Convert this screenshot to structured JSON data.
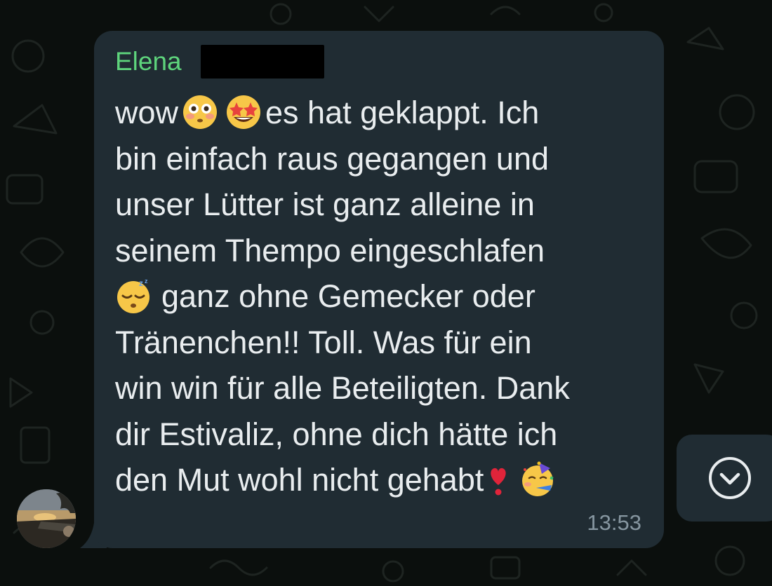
{
  "chat": {
    "sender_name": "Elena",
    "message_lines": [
      "wow",
      "es hat geklappt. Ich",
      "bin einfach raus gegangen und",
      "unser Lütter ist ganz alleine in",
      "seinem Thempo eingeschlafen",
      "ganz ohne Gemecker oder",
      "Tränenchen!! Toll. Was für ein",
      "win win für alle Beteiligten. Dank",
      "dir Estivaliz, ohne dich hätte ich",
      "den Mut wohl nicht gehabt"
    ],
    "timestamp": "13:53"
  },
  "icons": {
    "flushed_face": "flushed-face-emoji",
    "star_struck": "star-struck-emoji",
    "sleeping_face": "sleeping-face-emoji",
    "heart_exclamation": "heart-exclamation-emoji",
    "partying_face": "partying-face-emoji",
    "scroll_down": "chevron-down-circle-icon"
  },
  "colors": {
    "background": "#0b0f0d",
    "bubble": "#202c33",
    "sender_name": "#5ed47c",
    "message_text": "#e9edef",
    "timestamp": "#8696a0"
  }
}
